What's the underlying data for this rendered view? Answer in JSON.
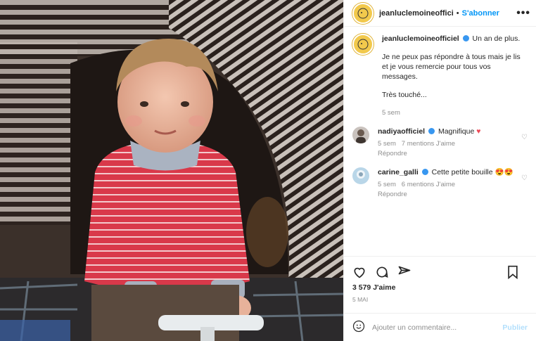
{
  "post": {
    "username": "jeanluclemoineofficiel",
    "header_username": "jeanluclemoineoffici",
    "follow_label": "S'abonner",
    "more_label": "•••",
    "caption": {
      "line1": "Un an de plus.",
      "line2": "Je ne peux pas répondre à tous mais je lis et je vous remercie pour tous vos messages.",
      "line3": "Très touché...",
      "time": "5 sem"
    },
    "comments": [
      {
        "user": "nadiyaofficiel",
        "text": "Magnifique",
        "emoji": "♥",
        "time": "5 sem",
        "likes": "7 mentions J'aime",
        "reply": "Répondre"
      },
      {
        "user": "carine_galli",
        "text": "Cette petite bouille",
        "emoji": "😍😍",
        "time": "5 sem",
        "likes": "6 mentions J'aime",
        "reply": "Répondre"
      }
    ],
    "likes": "3 579 J'aime",
    "date": "5 MAI",
    "add_comment_placeholder": "Ajouter un commentaire...",
    "publish_label": "Publier"
  },
  "colors": {
    "accent": "#0095f6",
    "verified": "#3897f0",
    "heart": "#ed4956",
    "avatar": "#f2c94c"
  },
  "icons": [
    "heart-icon",
    "comment-icon",
    "share-icon",
    "bookmark-icon",
    "emoji-icon",
    "verified-icon"
  ]
}
